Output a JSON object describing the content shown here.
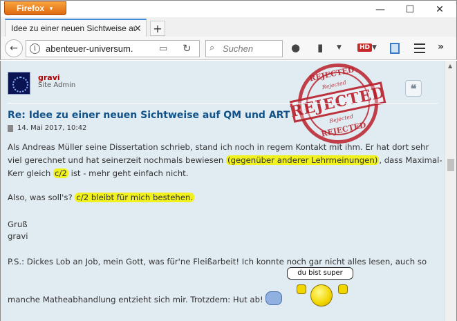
{
  "browser": {
    "menu_label": "Firefox",
    "tab_title": "Idee zu einer neuen Sichtweise auf",
    "url": "abenteuer-universum.",
    "search_placeholder": "Suchen",
    "hd_badge": "HD",
    "accent_color": "#e0680f"
  },
  "post": {
    "username": "gravi",
    "rank": "Site Admin",
    "stamp": {
      "main": "REJECTED",
      "top": "REJECTED",
      "mid": "Rejected",
      "bottom_small": "Rejected",
      "bottom": "REJECTED",
      "color": "#b8202a"
    },
    "title": "Re: Idee zu einer neuen Sichtweise auf QM und ART",
    "date": "14. Mai 2017, 10:42",
    "line1": "Als Andreas Müller seine Dissertation schrieb, stand ich noch in regem Kontakt mit ihm. Er hat dort sehr",
    "line2_pre": "viel gerechnet und hat seinerzeit nochmals bewiesen ",
    "line2_hl": "(gegenüber anderer Lehrmeinungen)",
    "line2_post": ", dass Maximal-",
    "line3_pre": "Kerr gleich ",
    "line3_hl": "c/2",
    "line3_post": " ist - mehr geht einfach nicht.",
    "line4_pre": "Also, was soll's? ",
    "line4_hl": "c/2 bleibt für mich bestehen.",
    "line5": "Gruß",
    "line6": "gravi",
    "line7": "P.S.: Dickes Lob an Job, mein Gott, was für'ne Fleißarbeit! Ich konnte noch gar nicht alles lesen, auch so",
    "line8": "manche Matheabhandlung entzieht sich mir. Trotzdem: Hut ab!",
    "speech": "du bist super",
    "highlight_color": "#f1f11e",
    "title_color": "#105289",
    "username_color": "#aa0000"
  }
}
